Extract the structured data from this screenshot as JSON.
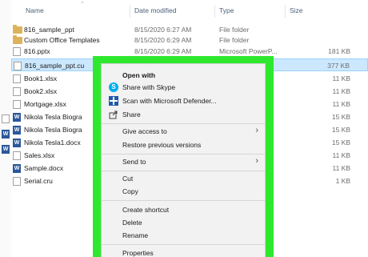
{
  "columns": {
    "name": "Name",
    "date": "Date modified",
    "type": "Type",
    "size": "Size"
  },
  "files": [
    {
      "name": "816_sample_ppt",
      "date": "8/15/2020 6:27 AM",
      "type": "File folder",
      "size": "",
      "icon": "folder-icon"
    },
    {
      "name": "Custom Office Templates",
      "date": "8/15/2020 6:29 AM",
      "type": "File folder",
      "size": "",
      "icon": "folder-icon"
    },
    {
      "name": "816.pptx",
      "date": "8/15/2020 6:29 AM",
      "type": "Microsoft PowerP...",
      "size": "181 KB",
      "icon": "document-icon"
    },
    {
      "name": "816_sample_ppt.cu",
      "date": "",
      "type": "",
      "size": "377 KB",
      "icon": "document-icon"
    },
    {
      "name": "Book1.xlsx",
      "date": "",
      "type": "",
      "size": "11 KB",
      "icon": "document-icon"
    },
    {
      "name": "Book2.xlsx",
      "date": "",
      "type": "",
      "size": "11 KB",
      "icon": "document-icon"
    },
    {
      "name": "Mortgage.xlsx",
      "date": "",
      "type": "",
      "size": "11 KB",
      "icon": "document-icon"
    },
    {
      "name": "Nikola Tesla Biogra",
      "date": "",
      "type": "",
      "size": "15 KB",
      "icon": "word-icon"
    },
    {
      "name": "Nikola Tesla Biogra",
      "date": "",
      "type": "",
      "size": "15 KB",
      "icon": "word-icon"
    },
    {
      "name": "Nikola Tesla1.docx",
      "date": "",
      "type": "",
      "size": "15 KB",
      "icon": "word-icon"
    },
    {
      "name": "Sales.xlsx",
      "date": "",
      "type": "",
      "size": "11 KB",
      "icon": "document-icon"
    },
    {
      "name": "Sample.docx",
      "date": "",
      "type": "",
      "size": "11 KB",
      "icon": "word-icon"
    },
    {
      "name": "Serial.cru",
      "date": "",
      "type": "",
      "size": "1 KB",
      "icon": "document-icon"
    }
  ],
  "context_menu": {
    "open_with": "Open with",
    "share_skype": "Share with Skype",
    "scan_defender": "Scan with Microsoft Defender...",
    "share": "Share",
    "give_access": "Give access to",
    "restore_versions": "Restore previous versions",
    "send_to": "Send to",
    "cut": "Cut",
    "copy": "Copy",
    "create_shortcut": "Create shortcut",
    "delete": "Delete",
    "rename": "Rename",
    "properties": "Properties"
  },
  "colors": {
    "highlight_frame": "#2ee82e",
    "selected_row": "#cce8ff",
    "folder": "#dcb35c"
  }
}
